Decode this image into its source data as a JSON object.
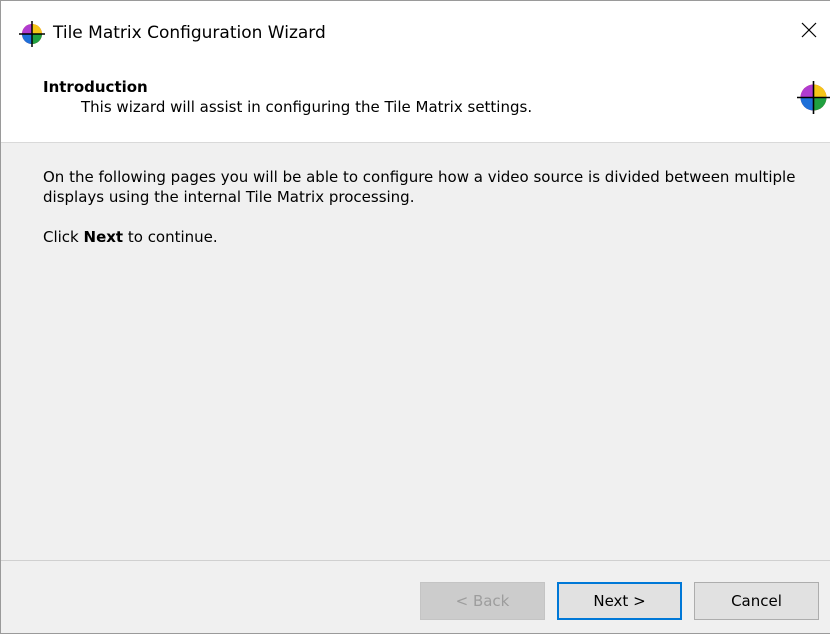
{
  "window": {
    "title": "Tile Matrix Configuration Wizard",
    "icon": "color-wheel-icon",
    "close_icon": "close-icon"
  },
  "header": {
    "title": "Introduction",
    "subtitle": "This wizard will assist in configuring the Tile Matrix settings.",
    "icon": "color-wheel-icon"
  },
  "content": {
    "paragraph1": "On the following pages you will be able to configure how a video source is divided between multiple displays using the internal Tile Matrix processing.",
    "instruction_prefix": "Click ",
    "instruction_bold": "Next",
    "instruction_suffix": " to continue."
  },
  "buttons": {
    "back": {
      "label": "< Back",
      "enabled": false
    },
    "next": {
      "label": "Next >",
      "enabled": true,
      "default": true
    },
    "cancel": {
      "label": "Cancel",
      "enabled": true
    }
  },
  "colors": {
    "accent": "#0078d7",
    "header_bg": "#ffffff",
    "body_bg": "#f0f0f0"
  }
}
